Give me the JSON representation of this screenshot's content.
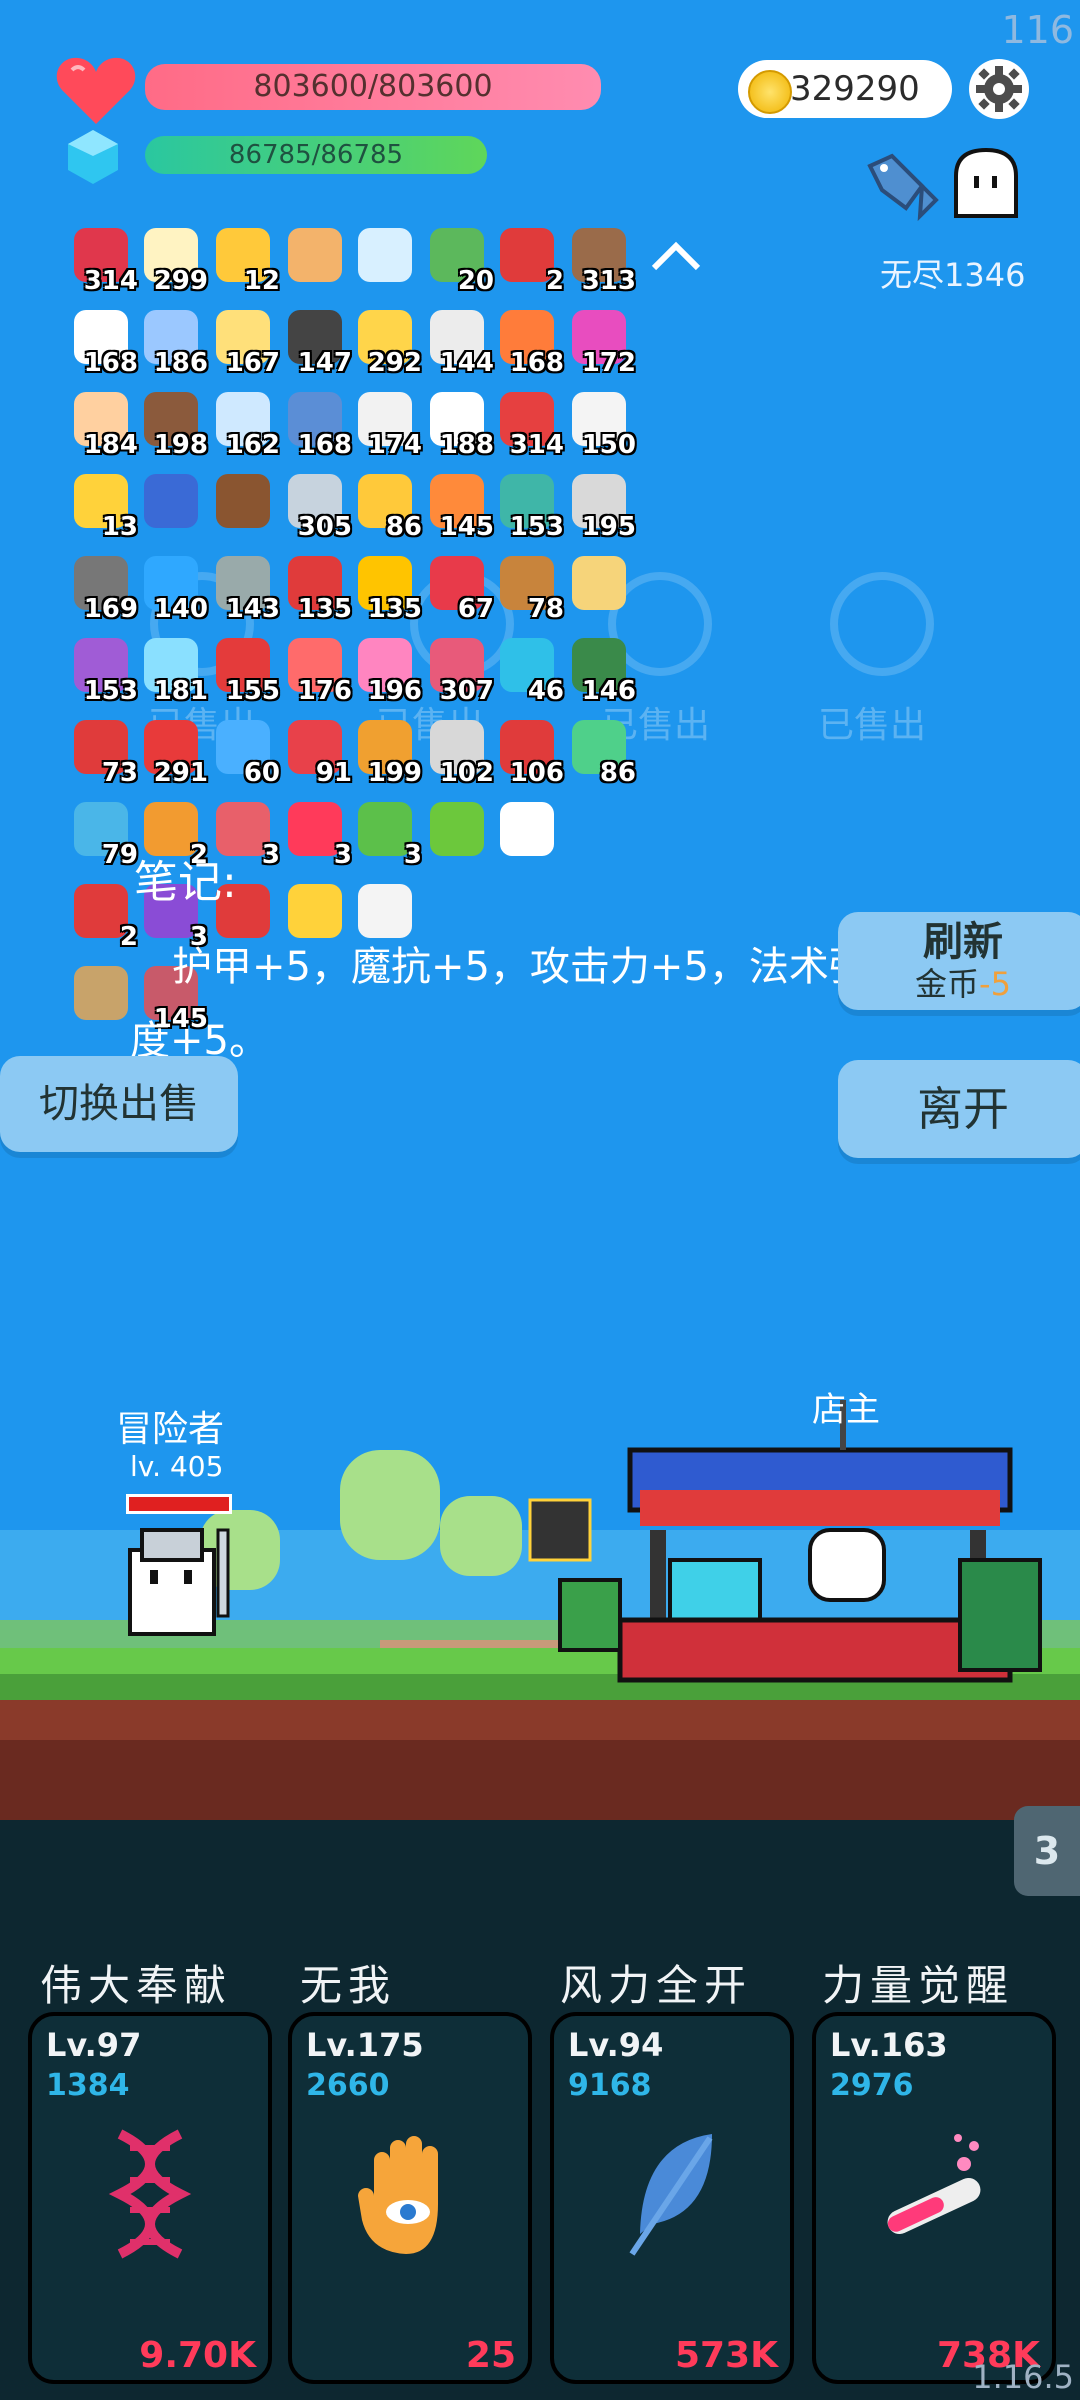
{
  "fps": "116",
  "version": "1.16.5",
  "status": {
    "hp": "803600/803600",
    "mp": "86785/86785",
    "coins": "329290",
    "endless": "无尽1346"
  },
  "colors": {
    "hp": "#ff7396",
    "mp": "#3fd08a",
    "sky": "#1e96ee",
    "price": "#ff3b5a",
    "xp": "#2fb6e8"
  },
  "items": [
    {
      "icon": "watermelon-icon",
      "color": "#e0374c",
      "count": "314"
    },
    {
      "icon": "egg-flower-icon",
      "color": "#fff3c2",
      "count": "299"
    },
    {
      "icon": "crown-icon",
      "color": "#ffc93a",
      "count": "12"
    },
    {
      "icon": "map-icon",
      "color": "#f3b36b",
      "count": ""
    },
    {
      "icon": "magnifier-icon",
      "color": "#d8f0ff",
      "count": ""
    },
    {
      "icon": "cash-heart-icon",
      "color": "#5cb85c",
      "count": "20"
    },
    {
      "icon": "magnet-icon",
      "color": "#e03b3b",
      "count": "2"
    },
    {
      "icon": "shield-round-icon",
      "color": "#9a6b4a",
      "count": "313"
    },
    {
      "icon": "clipboard-icon",
      "color": "#ffffff",
      "count": "168"
    },
    {
      "icon": "eraser-icon",
      "color": "#9bc8ff",
      "count": "186"
    },
    {
      "icon": "note-icon",
      "color": "#ffe07a",
      "count": "167"
    },
    {
      "icon": "cauldron-icon",
      "color": "#444",
      "count": "147"
    },
    {
      "icon": "star-card-icon",
      "color": "#ffd54a",
      "count": "292"
    },
    {
      "icon": "potion-white-icon",
      "color": "#ececec",
      "count": "144"
    },
    {
      "icon": "flag-icon",
      "color": "#ff7c3a",
      "count": "168"
    },
    {
      "icon": "bowl-icon",
      "color": "#e84dbf",
      "count": "172"
    },
    {
      "icon": "fist-icon",
      "color": "#ffd0a0",
      "count": "184"
    },
    {
      "icon": "helmet-icon",
      "color": "#8b5a3c",
      "count": "198"
    },
    {
      "icon": "halo-icon",
      "color": "#cfe9ff",
      "count": "162"
    },
    {
      "icon": "shield-icon",
      "color": "#5b8ed6",
      "count": "168"
    },
    {
      "icon": "dice-icon",
      "color": "#f2f2f2",
      "count": "174"
    },
    {
      "icon": "fried-egg-icon",
      "color": "#fff",
      "count": "188"
    },
    {
      "icon": "sock-icon",
      "color": "#e64040",
      "count": "314"
    },
    {
      "icon": "cards-icon",
      "color": "#f4f4f4",
      "count": "150"
    },
    {
      "icon": "sun-cloud-icon",
      "color": "#ffd23a",
      "count": "13"
    },
    {
      "icon": "tarot-icon",
      "color": "#3a6ad6",
      "count": ""
    },
    {
      "icon": "chest-icon",
      "color": "#8a5530",
      "count": ""
    },
    {
      "icon": "sword-icon",
      "color": "#c7d3de",
      "count": "305"
    },
    {
      "icon": "ring-icon",
      "color": "#ffc93a",
      "count": "86"
    },
    {
      "icon": "meteor-icon",
      "color": "#ff8a3a",
      "count": "145"
    },
    {
      "icon": "disc-icon",
      "color": "#3fb6a8",
      "count": "153"
    },
    {
      "icon": "feather-coin-icon",
      "color": "#d9d9d9",
      "count": "195"
    },
    {
      "icon": "mace-icon",
      "color": "#777",
      "count": "169"
    },
    {
      "icon": "chat-icon",
      "color": "#2fa8ff",
      "count": "140"
    },
    {
      "icon": "wings-icon",
      "color": "#9aa",
      "count": "143"
    },
    {
      "icon": "red-book-icon",
      "color": "#e03b3b",
      "count": "135"
    },
    {
      "icon": "sunflower-icon",
      "color": "#ffc400",
      "count": "135"
    },
    {
      "icon": "hearts-icon",
      "color": "#e83a4a",
      "count": "67"
    },
    {
      "icon": "bow-icon",
      "color": "#c8843c",
      "count": "78"
    },
    {
      "icon": "treasure-map-icon",
      "color": "#f6d47a",
      "count": ""
    },
    {
      "icon": "purple-shield-icon",
      "color": "#a05cd6",
      "count": "153"
    },
    {
      "icon": "bubble-icon",
      "color": "#8ae0ff",
      "count": "181"
    },
    {
      "icon": "gift-icon",
      "color": "#e43b3b",
      "count": "155"
    },
    {
      "icon": "pill-icon",
      "color": "#ff6b6b",
      "count": "176"
    },
    {
      "icon": "flask-icon",
      "color": "#ff85c0",
      "count": "196"
    },
    {
      "icon": "jar-icon",
      "color": "#e85a7a",
      "count": "307"
    },
    {
      "icon": "crystal-icon",
      "color": "#2fc0e8",
      "count": "46"
    },
    {
      "icon": "bomb-icon",
      "color": "#3a8a4a",
      "count": "146"
    },
    {
      "icon": "cherry-icon",
      "color": "#e03b3b",
      "count": "73"
    },
    {
      "icon": "apple-icon",
      "color": "#e83a3a",
      "count": "291"
    },
    {
      "icon": "target-icon",
      "color": "#4ab0ff",
      "count": "60"
    },
    {
      "icon": "big-heart-icon",
      "color": "#e8414a",
      "count": "91"
    },
    {
      "icon": "book-icon",
      "color": "#f0a030",
      "count": "199"
    },
    {
      "icon": "moon-icon",
      "color": "#d8d8d8",
      "count": "102"
    },
    {
      "icon": "strawberry-icon",
      "color": "#e03b3b",
      "count": "106"
    },
    {
      "icon": "slime-icon",
      "color": "#4fd08a",
      "count": "86"
    },
    {
      "icon": "scroll-blue-icon",
      "color": "#4ab6e8",
      "count": "79"
    },
    {
      "icon": "scroll-orange-icon",
      "color": "#f29b30",
      "count": "2"
    },
    {
      "icon": "meat-icon",
      "color": "#e8606a",
      "count": "3"
    },
    {
      "icon": "test-tube-icon",
      "color": "#ff3a5a",
      "count": "3"
    },
    {
      "icon": "goblin-icon",
      "color": "#5cc04a",
      "count": "3"
    },
    {
      "icon": "lime-icon",
      "color": "#6cc83c",
      "count": ""
    },
    {
      "icon": "ghost-icon",
      "color": "#ffffff",
      "count": ""
    },
    {
      "icon": "mushroom-icon",
      "color": "#e03b3b",
      "count": "2"
    },
    {
      "icon": "purple-box-icon",
      "color": "#8a4cd6",
      "count": "3"
    },
    {
      "icon": "bookmark-icon",
      "color": "#e03b3b",
      "count": ""
    },
    {
      "icon": "magic-wand-icon",
      "color": "#ffd23a",
      "count": ""
    },
    {
      "icon": "envelope-icon",
      "color": "#f4f4f4",
      "count": ""
    },
    {
      "icon": "noose-icon",
      "color": "#c8a36a",
      "count": ""
    },
    {
      "icon": "bandage-icon",
      "color": "#c85a6a",
      "count": "145"
    },
    {
      "icon": "bulb-icon",
      "color": "#e8ff6a",
      "count": ""
    }
  ],
  "sold": [
    "已售出",
    "已售出",
    "已售出",
    "已售出"
  ],
  "note": {
    "title": "笔记:",
    "body": "护甲+5，魔抗+5，攻击力+5，法术强度+5。"
  },
  "buttons": {
    "refresh": "刷新",
    "refresh_cost_label": "金币",
    "refresh_cost": "-5",
    "leave": "离开",
    "switch": "切换出售"
  },
  "scene": {
    "hero_name": "冒险者",
    "hero_level": "lv. 405",
    "shopkeeper": "店主"
  },
  "wave_count": "3",
  "skills": [
    {
      "name": "伟大奉献",
      "level": "Lv.97",
      "xp": "1384",
      "price": "9.70K",
      "icon": "dna-icon"
    },
    {
      "name": "无我",
      "level": "Lv.175",
      "xp": "2660",
      "price": "25",
      "icon": "eye-hand-icon"
    },
    {
      "name": "风力全开",
      "level": "Lv.94",
      "xp": "9168",
      "price": "573K",
      "icon": "feather-icon"
    },
    {
      "name": "力量觉醒",
      "level": "Lv.163",
      "xp": "2976",
      "price": "738K",
      "icon": "potion-tube-icon"
    }
  ]
}
